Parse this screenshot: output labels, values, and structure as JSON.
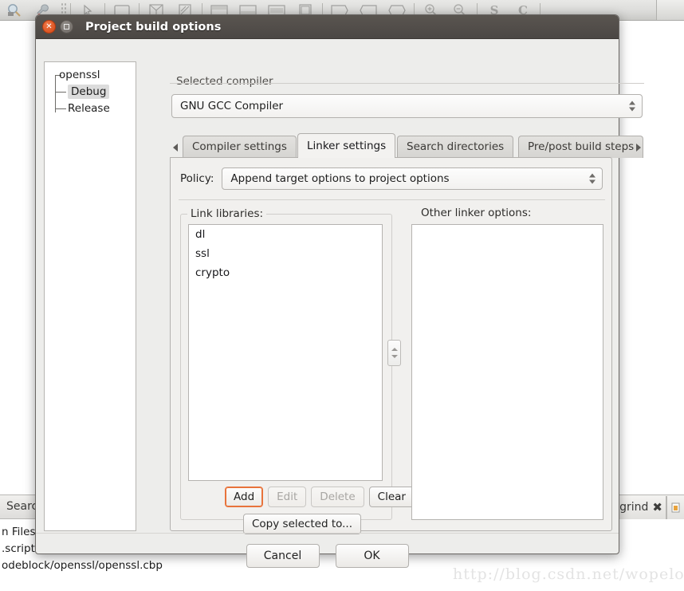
{
  "background": {
    "toolbar": {
      "icons": [
        "magnifier-search-icon",
        "wrench-icon",
        "toolbar-grip",
        "pointer-arrow-icon",
        "rectangle-icon",
        "split-grid-icon",
        "skew-box-icon",
        "panel-top-icon",
        "panel-bottom-icon",
        "panel-center-icon",
        "panel-right-icon",
        "tag-right-icon",
        "tag-left-icon",
        "tag-both-icon",
        "zoom-in-icon",
        "zoom-out-icon"
      ],
      "letter_s": "S",
      "letter_c": "C"
    },
    "search_tab_label": "Search",
    "right_tab_label": "lgrind",
    "right_tab_close": "✖",
    "log_lines": [
      "n Files p",
      ".script' registered under menu '&Settings/-Edit startup script'",
      "odeblock/openssl/openssl.cbp"
    ],
    "watermark": "http://blog.csdn.net/wopelo"
  },
  "dialog": {
    "title": "Project build options",
    "window_buttons": {
      "close": "close-icon",
      "maximize": "maximize-icon"
    },
    "tree": {
      "root": "openssl",
      "children": [
        "Debug",
        "Release"
      ],
      "selected": "Debug"
    },
    "selected_compiler": {
      "group_label": "Selected compiler",
      "value": "GNU GCC Compiler"
    },
    "tabs": {
      "scroll_left": "scroll-left-arrow",
      "scroll_right": "scroll-right-arrow",
      "items": [
        {
          "label": "Compiler settings",
          "active": false
        },
        {
          "label": "Linker settings",
          "active": true
        },
        {
          "label": "Search directories",
          "active": false
        },
        {
          "label": "Pre/post build steps",
          "active": false
        }
      ]
    },
    "policy": {
      "label": "Policy:",
      "value": "Append target options to project options"
    },
    "link_libraries": {
      "caption": "Link libraries:",
      "items": [
        "dl",
        "ssl",
        "crypto"
      ],
      "buttons": [
        {
          "label": "Add",
          "state": "focused"
        },
        {
          "label": "Edit",
          "state": "disabled"
        },
        {
          "label": "Delete",
          "state": "disabled"
        },
        {
          "label": "Clear",
          "state": "normal"
        }
      ],
      "copy_button": "Copy selected to...",
      "reorder": "reorder-spinner"
    },
    "other_linker_options": {
      "caption": "Other linker options:",
      "value": ""
    },
    "footer": {
      "cancel": "Cancel",
      "ok": "OK"
    }
  },
  "colors": {
    "titlebar": "#4f4a46",
    "accent_focus": "#e8733b",
    "dialog_bg": "#ededeb",
    "page_bg": "#f1f0ee",
    "selection": "#dcdcdc"
  }
}
